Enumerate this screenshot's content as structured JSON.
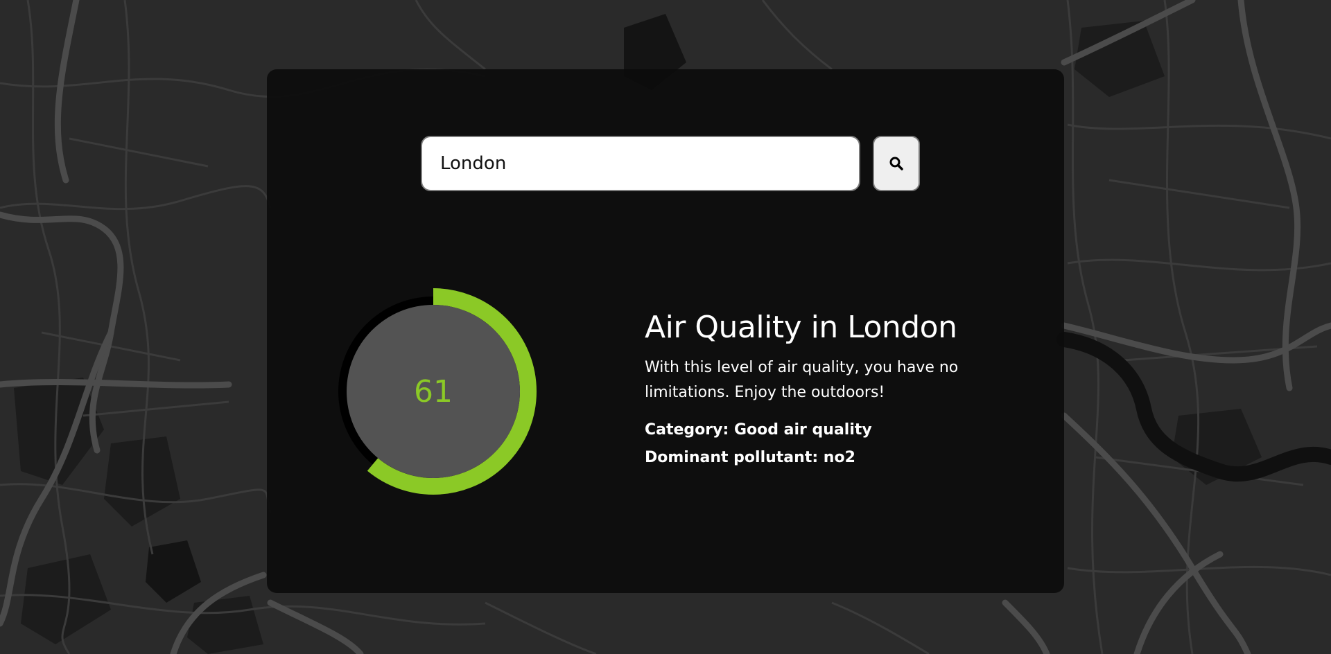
{
  "search": {
    "value": "London",
    "button_icon": "search-icon"
  },
  "result": {
    "aqi": "61",
    "aqi_fraction": 0.61,
    "gauge_color": "#8bc926",
    "title": "Air Quality in London",
    "description": "With this level of air quality, you have no limitations. Enjoy the outdoors!",
    "category": "Category: Good air quality",
    "pollutant": "Dominant pollutant: no2"
  },
  "background": {
    "type": "dark map of London"
  }
}
